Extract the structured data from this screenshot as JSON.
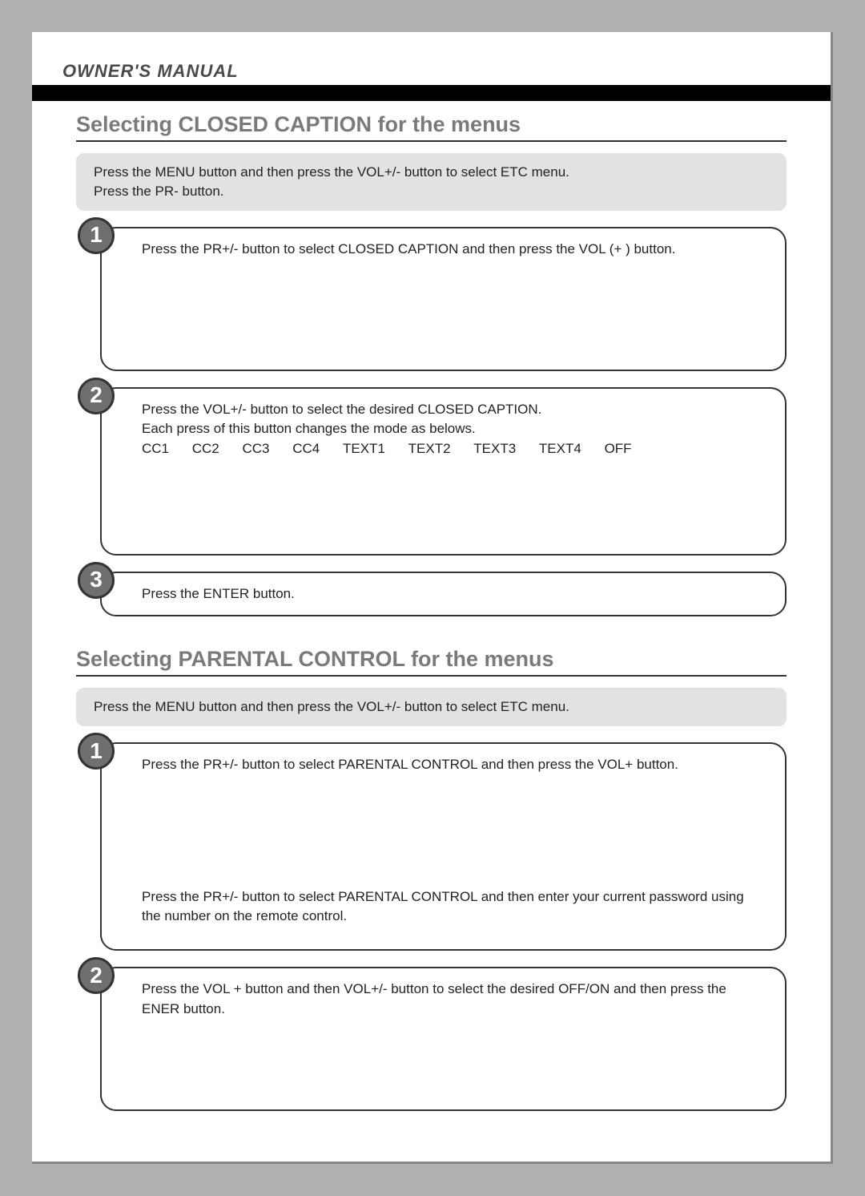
{
  "header": {
    "label": "OWNER'S MANUAL"
  },
  "section1": {
    "title": "Selecting CLOSED CAPTION for the menus",
    "intro_line1": "Press the MENU button and then press the VOL+/- button to select ETC menu.",
    "intro_line2": "Press the PR- button.",
    "step1": {
      "num": "1",
      "text": "Press the PR+/- button to select CLOSED CAPTION and then press the VOL (+ ) button."
    },
    "step2": {
      "num": "2",
      "line1": "Press the VOL+/- button to select the desired CLOSED CAPTION.",
      "line2": "Each press of this button changes the mode as belows.",
      "modes": [
        "CC1",
        "CC2",
        "CC3",
        "CC4",
        "TEXT1",
        "TEXT2",
        "TEXT3",
        "TEXT4",
        "OFF"
      ]
    },
    "step3": {
      "num": "3",
      "text": "Press the ENTER button."
    }
  },
  "section2": {
    "title": "Selecting PARENTAL CONTROL for the menus",
    "intro": "Press the MENU button and then press the VOL+/- button to select ETC menu.",
    "step1": {
      "num": "1",
      "para1": "Press the PR+/- button to select PARENTAL CONTROL and then press the VOL+ button.",
      "para2": "Press the PR+/- button to select PARENTAL CONTROL and then enter your current password using the number on the remote control."
    },
    "step2": {
      "num": "2",
      "text": "Press the VOL + button and then VOL+/- button to select the desired OFF/ON and then press the ENER button."
    }
  }
}
